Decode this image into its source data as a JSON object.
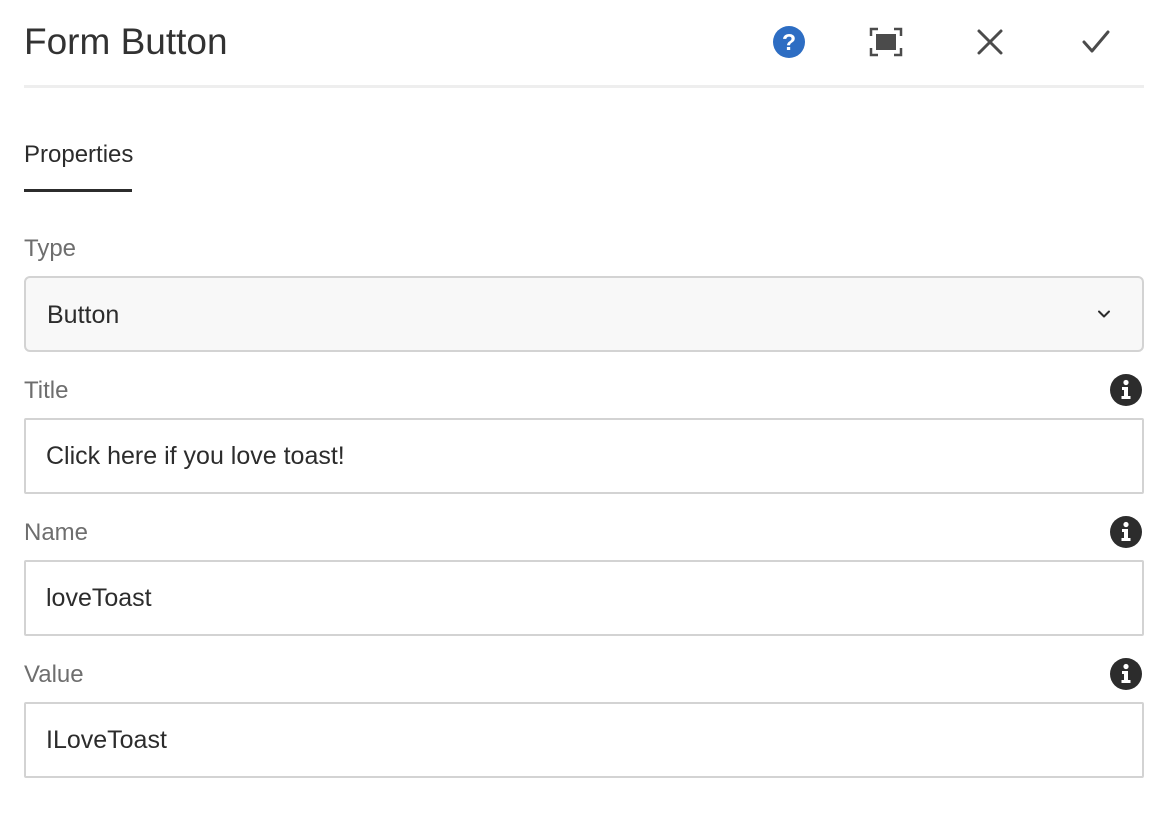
{
  "dialog": {
    "title": "Form Button",
    "actions": [
      {
        "name": "help",
        "icon": "help-circle-icon",
        "color": "#2d6dc3"
      },
      {
        "name": "fullscreen",
        "icon": "fullscreen-icon",
        "color": "#4b4b4b"
      },
      {
        "name": "cancel",
        "icon": "close-icon",
        "color": "#4b4b4b"
      },
      {
        "name": "done",
        "icon": "checkmark-icon",
        "color": "#4b4b4b"
      }
    ]
  },
  "tabs": [
    {
      "label": "Properties",
      "active": true
    }
  ],
  "fields": {
    "type": {
      "label": "Type",
      "value": "Button",
      "icon": "chevron-down-icon"
    },
    "title": {
      "label": "Title",
      "value": "Click here if you love toast!",
      "info_icon": "info-icon"
    },
    "name": {
      "label": "Name",
      "value": "loveToast",
      "info_icon": "info-icon"
    },
    "value": {
      "label": "Value",
      "value": "ILoveToast",
      "info_icon": "info-icon"
    }
  },
  "colors": {
    "accent": "#2d6dc3",
    "text": "#2c2c2c",
    "label": "#6e6e6e",
    "border": "#d3d3d3",
    "info_icon": "#2c2c2c"
  }
}
